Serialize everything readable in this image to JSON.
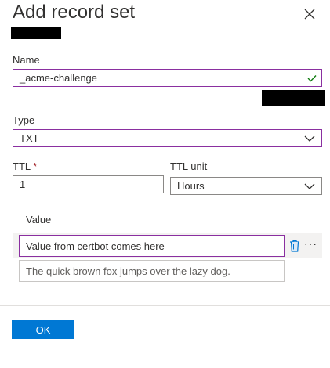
{
  "panel": {
    "title": "Add record set"
  },
  "form": {
    "name": {
      "label": "Name",
      "value": "_acme-challenge"
    },
    "type": {
      "label": "Type",
      "selected": "TXT"
    },
    "ttl": {
      "label": "TTL",
      "required_mark": "*",
      "value": "1"
    },
    "ttl_unit": {
      "label": "TTL unit",
      "selected": "Hours"
    }
  },
  "values": {
    "label": "Value",
    "rows": [
      {
        "value": "Value from certbot comes here"
      }
    ],
    "new_row_placeholder": "The quick brown fox jumps over the lazy dog.",
    "more_label": "···"
  },
  "footer": {
    "ok_label": "OK"
  },
  "colors": {
    "accent": "#0078d4",
    "focus_border": "#8a2fa0",
    "valid_check": "#107c10",
    "delete_icon": "#0078d4"
  },
  "icons": [
    "close-icon",
    "checkmark-icon",
    "chevron-down-icon",
    "delete-icon",
    "more-icon"
  ]
}
